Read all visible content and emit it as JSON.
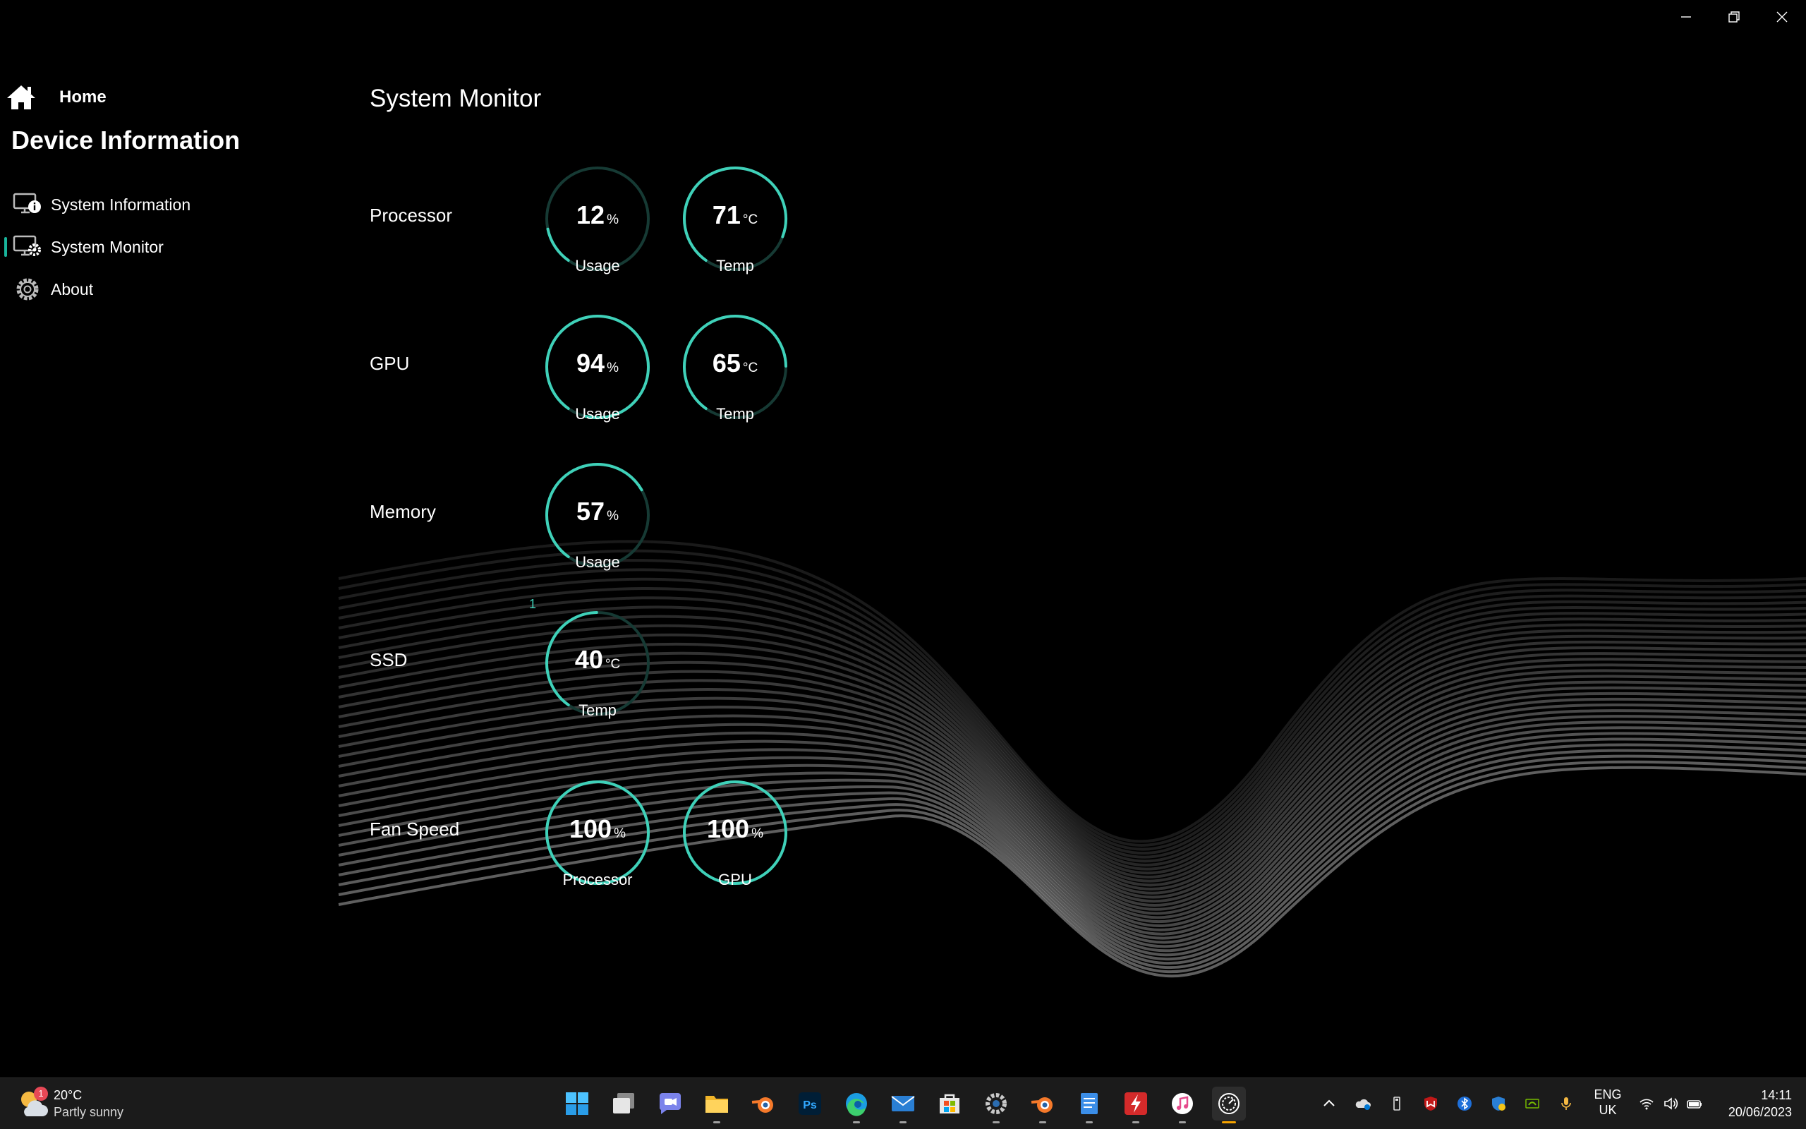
{
  "window": {
    "controls": [
      "minimize-icon",
      "restore-icon",
      "close-icon"
    ]
  },
  "sidebar": {
    "home_label": "Home",
    "section_title": "Device Information",
    "items": [
      {
        "label": "System Information",
        "icon": "monitor-info-icon",
        "active": false
      },
      {
        "label": "System Monitor",
        "icon": "monitor-gear-icon",
        "active": true
      },
      {
        "label": "About",
        "icon": "gear-icon",
        "active": false
      }
    ]
  },
  "main": {
    "title": "System Monitor",
    "sections": [
      {
        "label": "Processor",
        "gauges": [
          {
            "value": "12",
            "unit": "%",
            "caption": "Usage",
            "fraction": 0.12
          },
          {
            "value": "71",
            "unit": "°C",
            "caption": "Temp",
            "fraction": 0.71
          }
        ]
      },
      {
        "label": "GPU",
        "gauges": [
          {
            "value": "94",
            "unit": "%",
            "caption": "Usage",
            "fraction": 0.94
          },
          {
            "value": "65",
            "unit": "°C",
            "caption": "Temp",
            "fraction": 0.65
          }
        ]
      },
      {
        "label": "Memory",
        "gauges": [
          {
            "value": "57",
            "unit": "%",
            "caption": "Usage",
            "fraction": 0.57
          }
        ]
      },
      {
        "label": "SSD",
        "indicator": "1",
        "gauges": [
          {
            "value": "40",
            "unit": "°C",
            "caption": "Temp",
            "fraction": 0.4
          }
        ]
      },
      {
        "label": "Fan Speed",
        "gauges": [
          {
            "value": "100",
            "unit": "%",
            "caption": "Processor",
            "fraction": 1.0
          },
          {
            "value": "100",
            "unit": "%",
            "caption": "GPU",
            "fraction": 1.0
          }
        ]
      }
    ]
  },
  "colors": {
    "accent": "#3fd1b9",
    "track": "#163a34",
    "background": "#000000",
    "taskbar": "#1b1b1b"
  },
  "taskbar": {
    "weather": {
      "temp": "20°C",
      "condition": "Partly sunny",
      "badge": "1"
    },
    "apps": [
      "windows-start-icon",
      "task-view-icon",
      "chat-icon",
      "file-explorer-icon",
      "blender-icon",
      "photoshop-icon",
      "edge-icon",
      "mail-icon",
      "store-icon",
      "settings-icon",
      "blender-icon",
      "notepad-icon",
      "flash-icon",
      "itunes-icon",
      "system-monitor-app-icon"
    ],
    "tray": [
      "chevron-up-icon",
      "onedrive-icon",
      "usb-icon",
      "mcafee-icon",
      "bluetooth-icon",
      "defender-icon",
      "nvidia-icon",
      "microphone-icon",
      "wifi-icon",
      "volume-icon",
      "battery-icon"
    ],
    "language": {
      "line1": "ENG",
      "line2": "UK"
    },
    "time": "14:11",
    "date": "20/06/2023"
  }
}
